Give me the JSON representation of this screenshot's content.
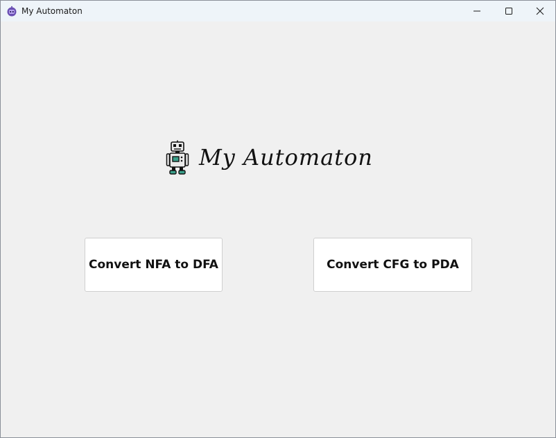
{
  "window": {
    "title": "My Automaton",
    "icon": "robot-icon"
  },
  "controls": {
    "minimize": "minimize-icon",
    "maximize": "maximize-icon",
    "close": "close-icon"
  },
  "main": {
    "heading": "My Automaton",
    "logo_icon": "robot-icon",
    "buttons": [
      {
        "label": "Convert NFA to DFA"
      },
      {
        "label": "Convert CFG to PDA"
      }
    ]
  },
  "colors": {
    "background": "#f0f0f0",
    "titlebar": "#eef4f9",
    "button_bg": "#ffffff",
    "robot_accent": "#3aa08a",
    "app_icon_purple": "#6a4fb3"
  }
}
